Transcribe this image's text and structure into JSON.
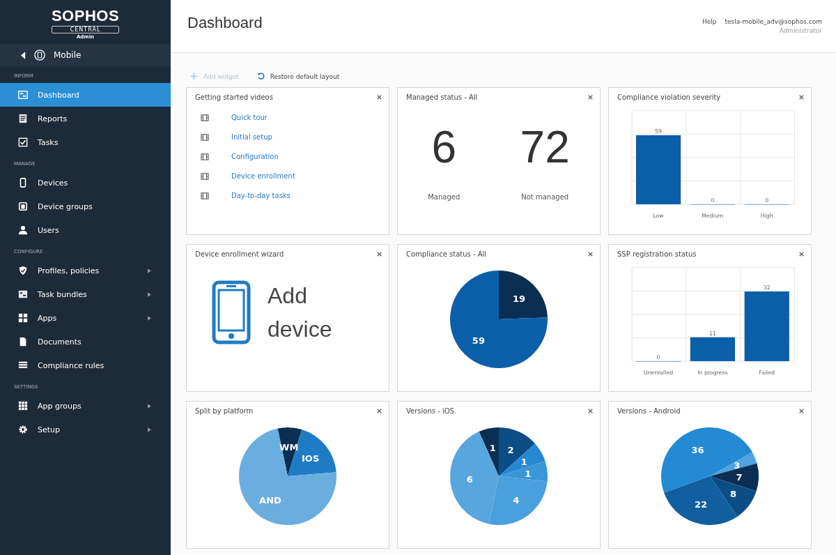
{
  "sidebar": {
    "logo": {
      "brand": "SOPHOS",
      "product": "CENTRAL",
      "role": "Admin"
    },
    "context": {
      "label": "Mobile"
    },
    "sections": [
      {
        "heading": "INFORM",
        "items": [
          {
            "label": "Dashboard",
            "selected": true,
            "has_submenu": false
          },
          {
            "label": "Reports",
            "selected": false,
            "has_submenu": false
          },
          {
            "label": "Tasks",
            "selected": false,
            "has_submenu": false
          }
        ]
      },
      {
        "heading": "MANAGE",
        "items": [
          {
            "label": "Devices",
            "selected": false,
            "has_submenu": false
          },
          {
            "label": "Device groups",
            "selected": false,
            "has_submenu": false
          },
          {
            "label": "Users",
            "selected": false,
            "has_submenu": false
          }
        ]
      },
      {
        "heading": "CONFIGURE",
        "items": [
          {
            "label": "Profiles, policies",
            "selected": false,
            "has_submenu": true
          },
          {
            "label": "Task bundles",
            "selected": false,
            "has_submenu": true
          },
          {
            "label": "Apps",
            "selected": false,
            "has_submenu": true
          },
          {
            "label": "Documents",
            "selected": false,
            "has_submenu": false
          },
          {
            "label": "Compliance rules",
            "selected": false,
            "has_submenu": false
          }
        ]
      },
      {
        "heading": "SETTINGS",
        "items": [
          {
            "label": "App groups",
            "selected": false,
            "has_submenu": true
          },
          {
            "label": "Setup",
            "selected": false,
            "has_submenu": true
          }
        ]
      }
    ]
  },
  "header": {
    "title": "Dashboard",
    "help": "Help",
    "user": "tesla-mobile_adv@sophos.com",
    "role": "Administrator"
  },
  "toolbar": [
    {
      "label": "Add widget",
      "kind": "add",
      "disabled": true
    },
    {
      "label": "Restore default layout",
      "kind": "restore",
      "disabled": false
    }
  ],
  "widgets": [
    {
      "kind": "videos",
      "title": "Getting started videos",
      "links": [
        "Quick tour",
        "Initial setup",
        "Configuration",
        "Device enrollment",
        "Day-to-day tasks"
      ]
    },
    {
      "kind": "managed",
      "title": "Managed status - All",
      "stats": [
        {
          "value": "6",
          "label": "Managed"
        },
        {
          "value": "72",
          "label": "Not managed"
        }
      ]
    },
    {
      "kind": "chart",
      "title": "Compliance violation severity",
      "chart_data": {
        "type": "bar",
        "categories": [
          "Low",
          "Medium",
          "High"
        ],
        "values": [
          59,
          0,
          0
        ],
        "ylim": [
          0,
          80
        ],
        "data_labels": true
      }
    },
    {
      "kind": "wizard",
      "title": "Device enrollment wizard",
      "action": "Add device"
    },
    {
      "kind": "chart",
      "title": "Compliance status - All",
      "chart_data": {
        "type": "pie",
        "values": [
          19,
          59
        ],
        "colors": [
          "#0b2f52",
          "#0b5fa8"
        ],
        "data_labels": true
      }
    },
    {
      "kind": "chart",
      "title": "SSP registration status",
      "chart_data": {
        "type": "bar",
        "categories": [
          "Unenrolled",
          "In progress",
          "Failed"
        ],
        "values": [
          0,
          11,
          32
        ],
        "ylim": [
          0,
          43
        ],
        "data_labels": true
      }
    },
    {
      "kind": "chart",
      "title": "Split by platform",
      "chart_data": {
        "type": "pie",
        "categories": [
          "WM",
          "IOS",
          "AND"
        ],
        "values": [
          8,
          19,
          73
        ],
        "colors": [
          "#0b2f52",
          "#1f7cc4",
          "#6aaee0"
        ]
      }
    },
    {
      "kind": "chart",
      "title": "Versions - iOS",
      "chart_data": {
        "type": "pie",
        "values": [
          1,
          2,
          1,
          1,
          4,
          6
        ],
        "colors": [
          "#0b2f52",
          "#0c4d86",
          "#2588d0",
          "#3b96d8",
          "#4aa0dd",
          "#57a6de"
        ],
        "data_labels": true
      }
    },
    {
      "kind": "chart",
      "title": "Versions - Android",
      "chart_data": {
        "type": "pie",
        "values": [
          36,
          3,
          7,
          8,
          22
        ],
        "colors": [
          "#238ad3",
          "#4ea3e0",
          "#0b2f52",
          "#0c4d86",
          "#115f9e"
        ],
        "data_labels": true
      }
    }
  ]
}
